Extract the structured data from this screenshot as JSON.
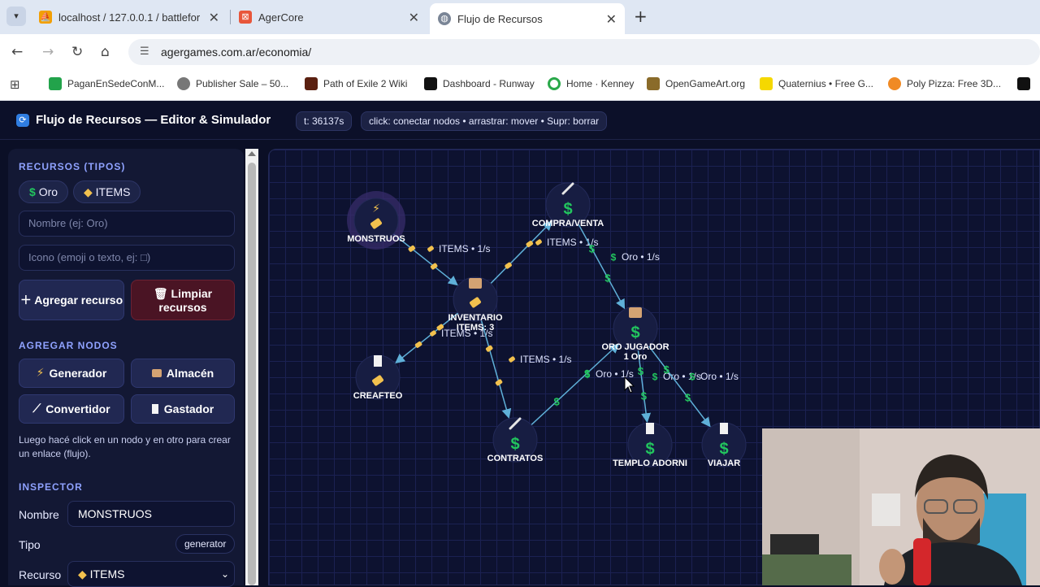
{
  "browser": {
    "tabs": [
      {
        "label": "localhost / 127.0.0.1 / battlefor",
        "icon": "phpmyadmin-icon"
      },
      {
        "label": "AgerCore",
        "icon": "app-icon"
      },
      {
        "label": "Flujo de Recursos",
        "icon": "globe-icon"
      }
    ],
    "url": "agergames.com.ar/economia/",
    "bookmarks": [
      "PaganEnSedeConM...",
      "Publisher Sale – 50...",
      "Path of Exile 2 Wiki",
      "Dashboard - Runway",
      "Home · Kenney",
      "OpenGameArt.org",
      "Quaternius • Free G...",
      "Poly Pizza: Free 3D..."
    ]
  },
  "header": {
    "title": "Flujo de Recursos — Editor & Simulador",
    "time": "t: 36137s",
    "help": "click: conectar nodos • arrastrar: mover • Supr: borrar"
  },
  "sidebar": {
    "resources_title": "RECURSOS (TIPOS)",
    "resources": [
      {
        "icon": "$",
        "label": "Oro"
      },
      {
        "icon": "tag",
        "label": "ITEMS"
      }
    ],
    "name_placeholder": "Nombre (ej: Oro)",
    "icon_placeholder": "Icono (emoji o texto, ej: □)",
    "add_resource": "Agregar recurso",
    "clear_resources": "Limpiar recursos",
    "nodes_title": "AGREGAR NODOS",
    "node_buttons": [
      "Generador",
      "Almacén",
      "Convertidor",
      "Gastador"
    ],
    "hint": "Luego hacé click en un nodo y en otro para crear un enlace (flujo).",
    "inspector_title": "INSPECTOR",
    "name_label": "Nombre",
    "name_value": "MONSTRUOS",
    "type_label": "Tipo",
    "type_value": "generator",
    "resource_label": "Recurso",
    "resource_value": "ITEMS"
  },
  "graph": {
    "nodes": [
      {
        "id": "monstruos",
        "label": "MONSTRUOS",
        "kind": "generator",
        "resource": "tag"
      },
      {
        "id": "compra",
        "label": "COMPRA/VENTA",
        "kind": "converter",
        "resource": "$"
      },
      {
        "id": "inventario",
        "label": "INVENTARIO",
        "sublabel": "ITEMS: 3",
        "kind": "storage",
        "resource": "tag"
      },
      {
        "id": "oro",
        "label": "ORO JUGADOR",
        "sublabel": "1 Oro",
        "kind": "storage",
        "resource": "$"
      },
      {
        "id": "crafteo",
        "label": "CREAFTEO",
        "kind": "sink",
        "resource": "tag"
      },
      {
        "id": "contratos",
        "label": "CONTRATOS",
        "kind": "converter",
        "resource": "$"
      },
      {
        "id": "templo",
        "label": "TEMPLO ADORNI",
        "kind": "sink",
        "resource": "$"
      },
      {
        "id": "viajar",
        "label": "VIAJAR",
        "kind": "sink",
        "resource": "$"
      }
    ],
    "edges": [
      {
        "from": "monstruos",
        "to": "inventario",
        "label": "ITEMS • 1/s",
        "resource": "tag"
      },
      {
        "from": "inventario",
        "to": "compra",
        "label": "ITEMS • 1/s",
        "resource": "tag"
      },
      {
        "from": "compra",
        "to": "oro",
        "label": "Oro • 1/s",
        "resource": "$"
      },
      {
        "from": "inventario",
        "to": "crafteo",
        "label": "ITEMS • 1/s",
        "resource": "tag"
      },
      {
        "from": "inventario",
        "to": "contratos",
        "label": "ITEMS • 1/s",
        "resource": "tag"
      },
      {
        "from": "contratos",
        "to": "oro",
        "label": "Oro • 1/s",
        "resource": "$"
      },
      {
        "from": "oro",
        "to": "templo",
        "label": "Oro • 1/s",
        "resource": "$"
      },
      {
        "from": "oro",
        "to": "viajar",
        "label": "Oro • 1/s",
        "resource": "$"
      }
    ]
  },
  "colors": {
    "accent": "#8fa2ff",
    "edge": "#5fb0d8",
    "gold": "#22c55e",
    "tag": "#f2c14e"
  }
}
